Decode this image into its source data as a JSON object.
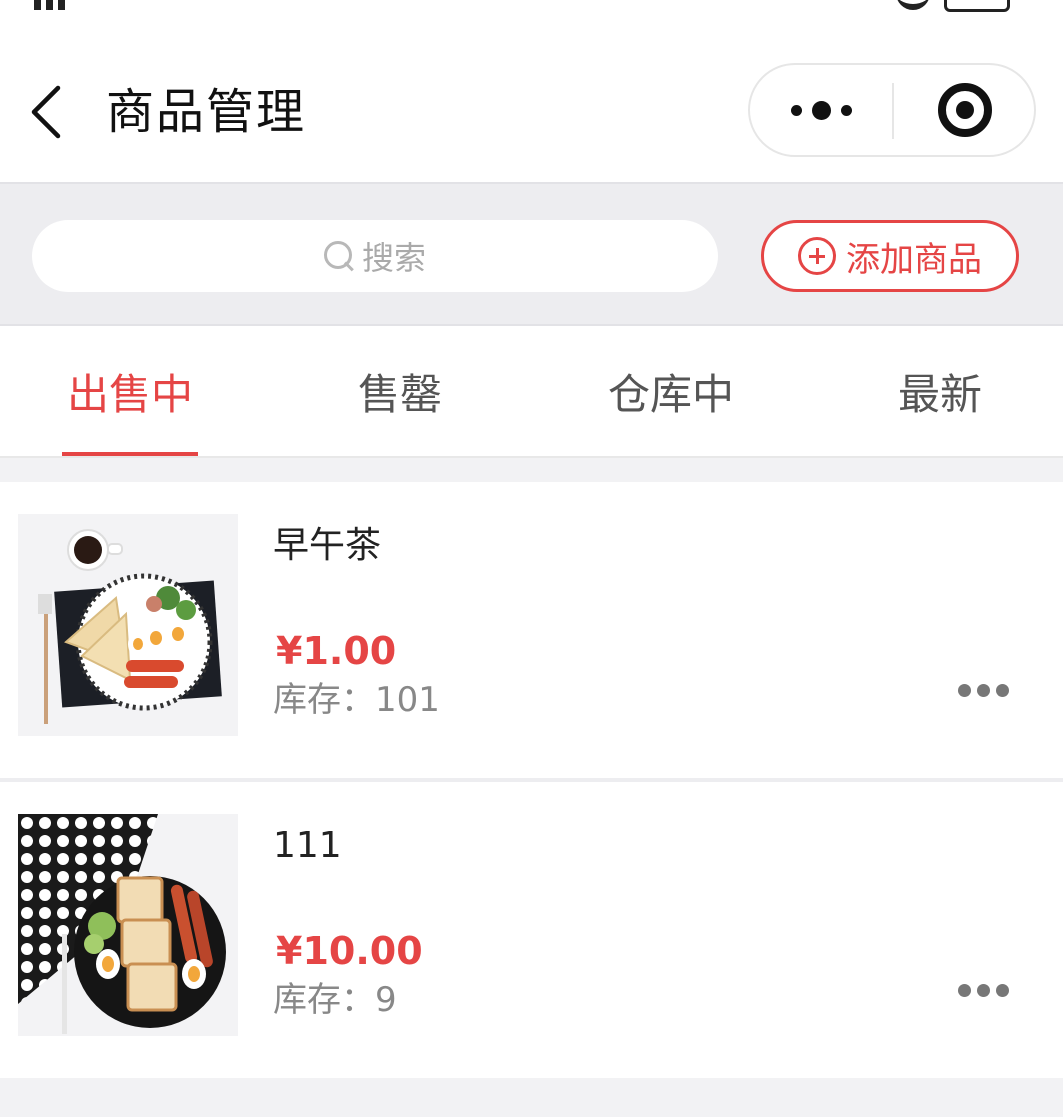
{
  "nav": {
    "title": "商品管理"
  },
  "search": {
    "placeholder": "搜索"
  },
  "add_button": {
    "label": "添加商品"
  },
  "tabs": [
    {
      "label": "出售中",
      "active": true
    },
    {
      "label": "售罄",
      "active": false
    },
    {
      "label": "仓库中",
      "active": false
    },
    {
      "label": "最新",
      "active": false
    }
  ],
  "products": [
    {
      "name": "早午茶",
      "price": "¥1.00",
      "stock_label": "库存：",
      "stock": "101"
    },
    {
      "name": "111",
      "price": "¥10.00",
      "stock_label": "库存：",
      "stock": "9"
    }
  ],
  "colors": {
    "accent": "#e54545",
    "background_strip": "#ededf0",
    "text_primary": "#222222",
    "text_secondary": "#888888"
  },
  "icons": {
    "back": "chevron-left-icon",
    "capsule_more": "more-dots-icon",
    "capsule_close": "target-icon",
    "search": "search-icon",
    "add": "plus-circle-icon",
    "item_more": "ellipsis-icon"
  }
}
